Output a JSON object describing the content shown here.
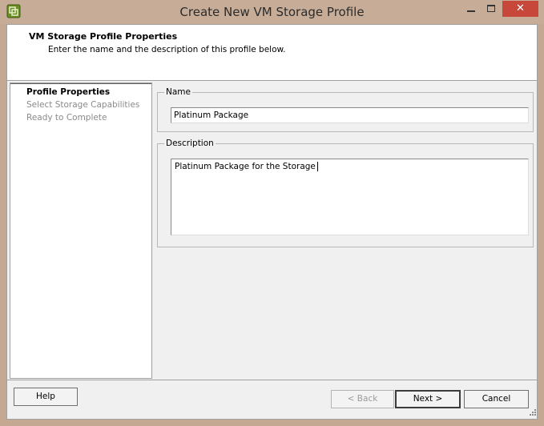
{
  "window": {
    "title": "Create New VM Storage Profile",
    "close_glyph": "✕"
  },
  "header": {
    "title": "VM Storage Profile Properties",
    "description": "Enter the name and the description of this profile below."
  },
  "nav": {
    "items": [
      {
        "label": "Profile Properties",
        "active": true
      },
      {
        "label": "Select Storage Capabilities",
        "active": false
      },
      {
        "label": "Ready to Complete",
        "active": false
      }
    ]
  },
  "form": {
    "name": {
      "legend": "Name",
      "value": "Platinum Package"
    },
    "description": {
      "legend": "Description",
      "value": "Platinum Package for the Storage"
    }
  },
  "buttons": {
    "help": "Help",
    "back": "< Back",
    "next": "Next >",
    "cancel": "Cancel"
  },
  "colors": {
    "title_bar": "#c7ad98",
    "close_button": "#c7473b",
    "dialog_background": "#f0f0f0"
  },
  "icons": {
    "app": "vsphere-app-icon",
    "minimize": "minimize-icon",
    "maximize": "maximize-icon",
    "close": "close-icon",
    "resize": "resize-grip-icon"
  }
}
